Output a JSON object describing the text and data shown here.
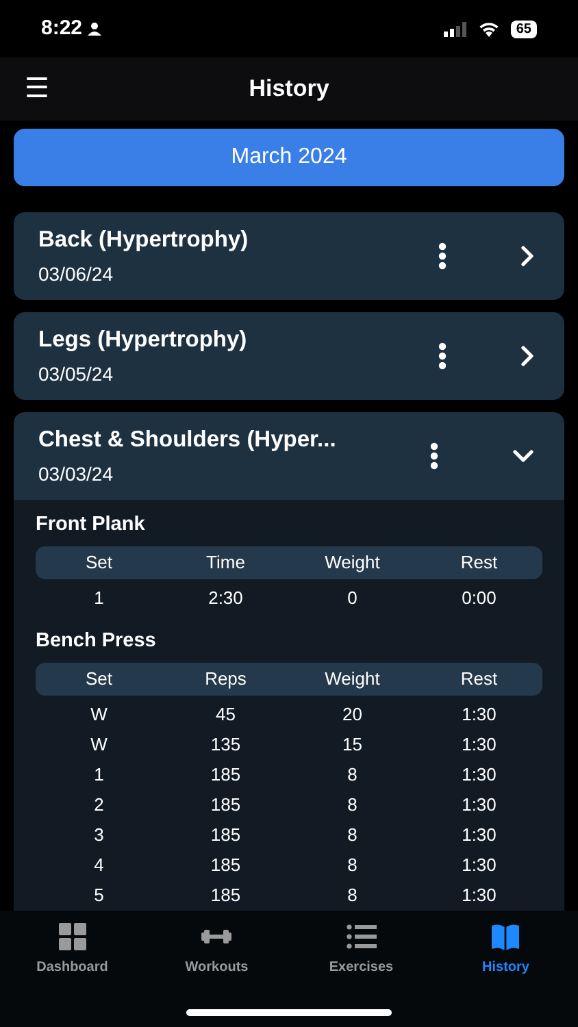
{
  "status_bar": {
    "time": "8:22",
    "battery": "65"
  },
  "header": {
    "menu": "☰",
    "title": "History"
  },
  "month": {
    "label": "March 2024"
  },
  "workouts": [
    {
      "name": "Back (Hypertrophy)",
      "date": "03/06/24",
      "expanded": false
    },
    {
      "name": "Legs (Hypertrophy)",
      "date": "03/05/24",
      "expanded": false
    },
    {
      "name": "Chest & Shoulders (Hyper...",
      "date": "03/03/24",
      "expanded": true,
      "exercises": [
        {
          "name": "Front Plank",
          "columns": [
            "Set",
            "Time",
            "Weight",
            "Rest"
          ],
          "rows": [
            [
              "1",
              "2:30",
              "0",
              "0:00"
            ]
          ]
        },
        {
          "name": "Bench Press",
          "columns": [
            "Set",
            "Reps",
            "Weight",
            "Rest"
          ],
          "rows": [
            [
              "W",
              "45",
              "20",
              "1:30"
            ],
            [
              "W",
              "135",
              "15",
              "1:30"
            ],
            [
              "1",
              "185",
              "8",
              "1:30"
            ],
            [
              "2",
              "185",
              "8",
              "1:30"
            ],
            [
              "3",
              "185",
              "8",
              "1:30"
            ],
            [
              "4",
              "185",
              "8",
              "1:30"
            ],
            [
              "5",
              "185",
              "8",
              "1:30"
            ]
          ]
        }
      ]
    }
  ],
  "tab_bar": [
    {
      "label": "Dashboard",
      "kind": "grid",
      "selected": false
    },
    {
      "label": "Workouts",
      "kind": "dumbbell",
      "selected": false
    },
    {
      "label": "Exercises",
      "kind": "list",
      "selected": false
    },
    {
      "label": "History",
      "kind": "book",
      "selected": true
    }
  ]
}
